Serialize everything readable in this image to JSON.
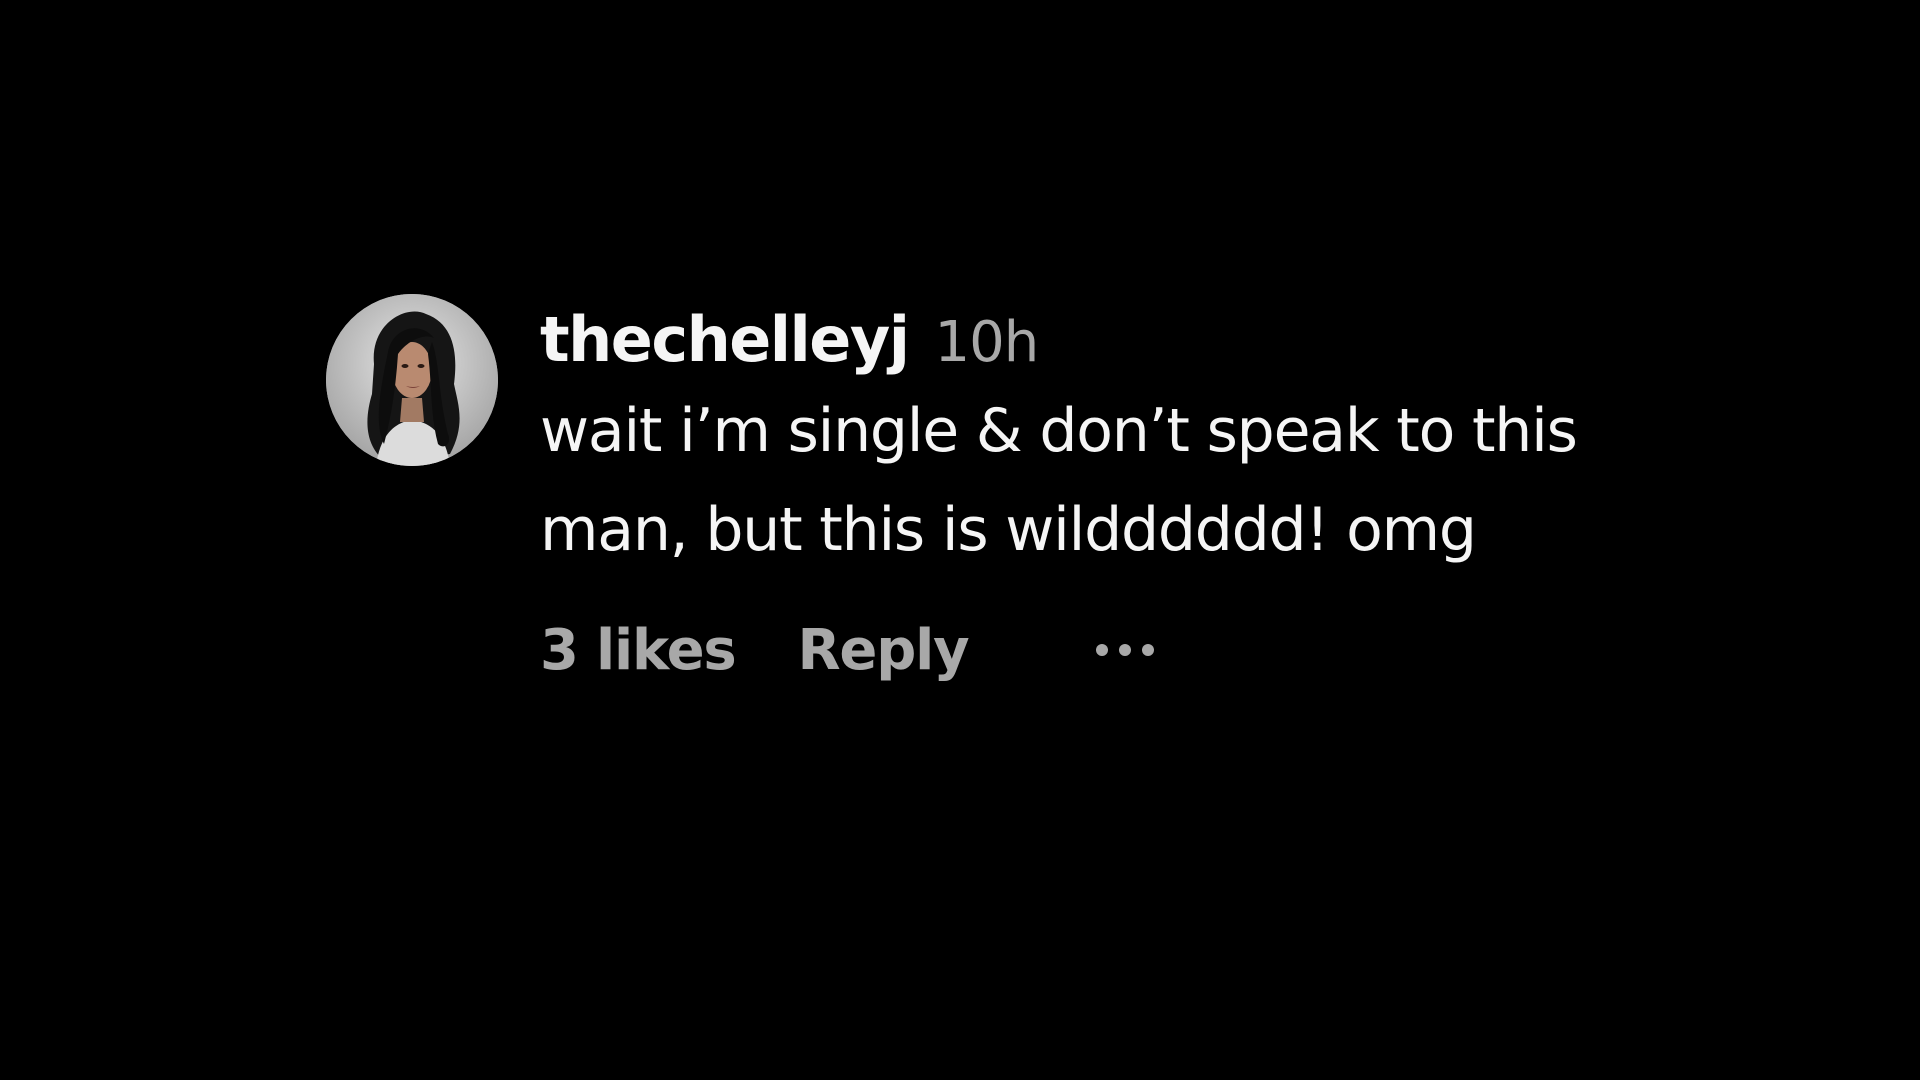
{
  "comment": {
    "avatar_icon": "profile-photo",
    "username": "thechelleyj",
    "timestamp": "10h",
    "text": "wait i’m single & don’t speak to this man, but this is wildddddd! omg",
    "likes": "3 likes",
    "reply_label": "Reply",
    "more_icon": "ellipsis-icon"
  },
  "colors": {
    "background": "#000000",
    "primary_text": "#f5f5f5",
    "secondary_text": "#a8a8a8"
  }
}
